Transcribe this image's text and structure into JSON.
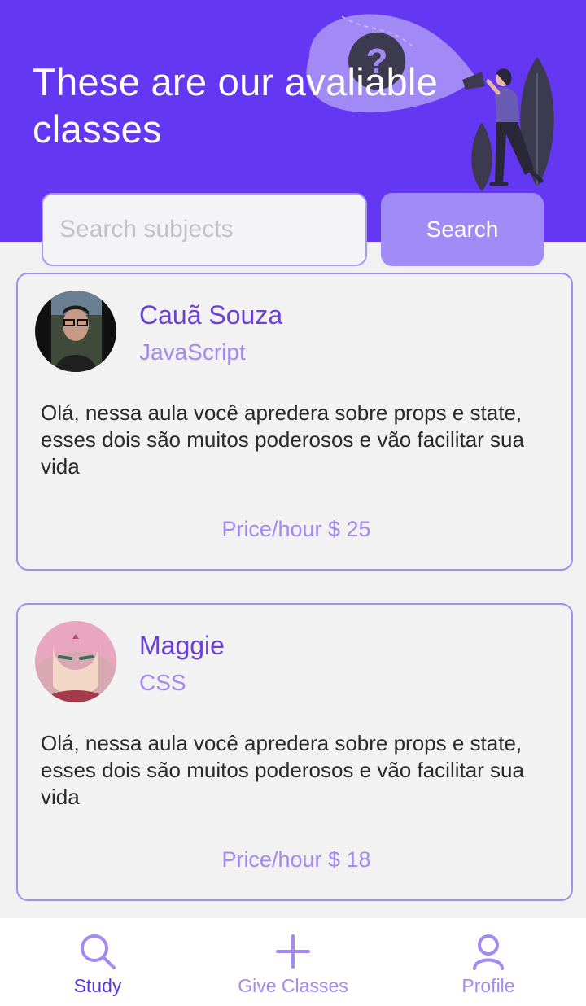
{
  "header": {
    "title": "These are our avaliable classes",
    "illustration_icon": "question-mark-megaphone-illustration"
  },
  "search": {
    "placeholder": "Search subjects",
    "value": "",
    "button_label": "Search"
  },
  "classes": [
    {
      "name": "Cauã Souza",
      "subject": "JavaScript",
      "description": "Olá, nessa aula você apredera sobre props e state, esses dois são muitos poderosos e vão facilitar sua vida",
      "price": "Price/hour $ 25"
    },
    {
      "name": "Maggie",
      "subject": "CSS",
      "description": "Olá, nessa aula você apredera sobre props e state, esses dois são muitos poderosos e vão facilitar sua vida",
      "price": "Price/hour $ 18"
    }
  ],
  "nav": {
    "items": [
      {
        "label": "Study",
        "icon": "search-icon",
        "active": true
      },
      {
        "label": "Give Classes",
        "icon": "plus-icon",
        "active": false
      },
      {
        "label": "Profile",
        "icon": "user-icon",
        "active": false
      }
    ]
  },
  "colors": {
    "primary": "#6438f3",
    "accent_light": "#a18bf7",
    "text_purple": "#6a40d8",
    "nav_active": "#5b35d5"
  }
}
